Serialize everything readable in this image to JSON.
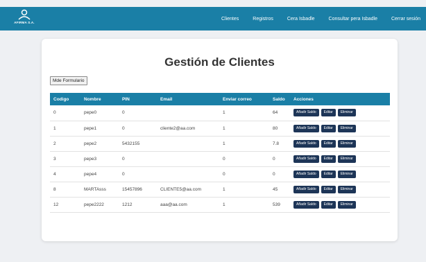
{
  "navbar": {
    "brand": "AFIRMA S.A.",
    "links": [
      "Clientes",
      "Registros",
      "Cera Isbadle",
      "Consultar pera Isbadle",
      "Cerrar sesión"
    ]
  },
  "main": {
    "title": "Gestión de Clientes",
    "toggle_form": "Mde Formulario"
  },
  "table": {
    "headers": [
      "Codigo",
      "Nombre",
      "PIN",
      "Email",
      "Enviar correo",
      "Saldo",
      "Acciones"
    ],
    "action_labels": [
      "Añadir Saldo",
      "Editar",
      "Eliminar"
    ],
    "rows": [
      [
        "0",
        "pepe0",
        "0",
        "",
        "1",
        "64"
      ],
      [
        "1",
        "pepe1",
        "0",
        "cliente2@aa.com",
        "1",
        "80"
      ],
      [
        "2",
        "pepe2",
        "5432155",
        "",
        "1",
        "7.8"
      ],
      [
        "3",
        "pepe3",
        "0",
        "",
        "0",
        "0"
      ],
      [
        "4",
        "pepe4",
        "0",
        "",
        "0",
        "0"
      ],
      [
        "8",
        "MARTAsss",
        "15457896",
        "CLIENTE5@aa.com",
        "1",
        "45"
      ],
      [
        "12",
        "pepe2222",
        "1212",
        "aaa@aa.com",
        "1",
        "539"
      ]
    ]
  },
  "colors": {
    "brand": "#1a7fa6",
    "action_button": "#1d3557",
    "background": "#eef0f3"
  }
}
